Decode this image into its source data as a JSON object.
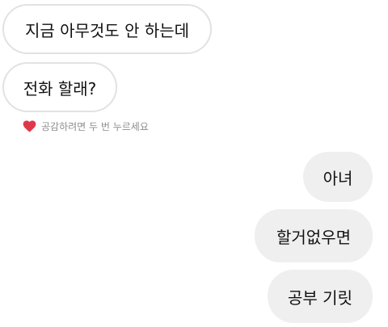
{
  "messages": {
    "incoming": [
      {
        "text": "지금 아무것도 안 하는데"
      },
      {
        "text": "전화 할래?"
      }
    ],
    "reaction_hint": {
      "icon": "heart-icon",
      "text": "공감하려면 두 번 누르세요",
      "icon_color": "#e0384b"
    },
    "outgoing": [
      {
        "text": "아녀"
      },
      {
        "text": "할거없우면"
      },
      {
        "text": "공부 기릿"
      }
    ]
  },
  "colors": {
    "incoming_bubble_border": "#e2e2e2",
    "outgoing_bubble_bg": "#efefef",
    "text": "#111111",
    "hint_text": "#8e8e8e"
  }
}
